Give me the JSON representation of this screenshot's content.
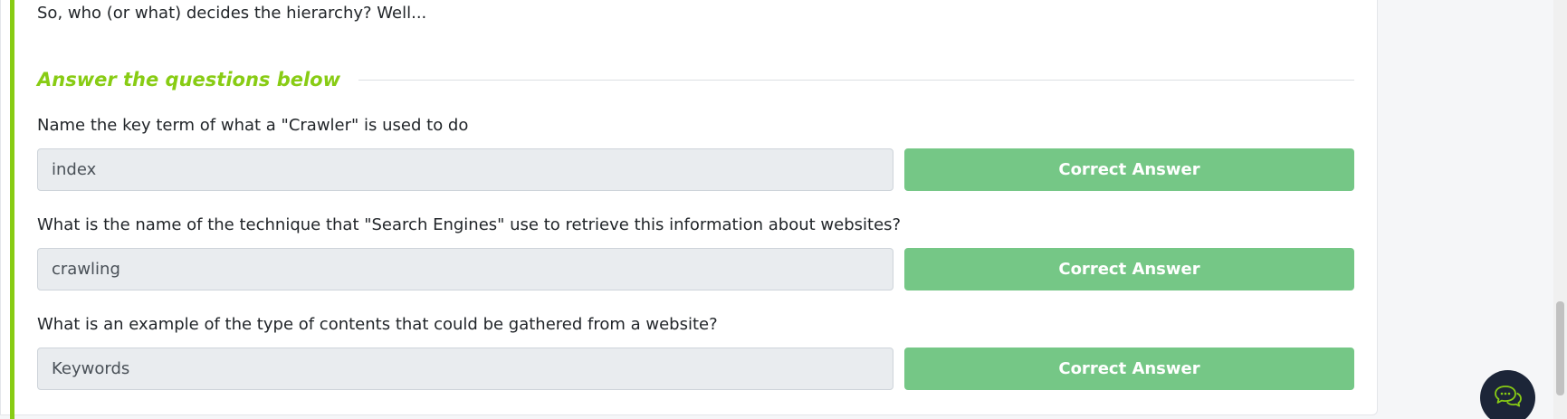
{
  "intro": {
    "text": "So, who (or what) decides the hierarchy? Well..."
  },
  "section": {
    "title": "Answer the questions below"
  },
  "questions": [
    {
      "text": "Name the key term of what a \"Crawler\" is used to do",
      "answer": "index",
      "button_label": "Correct Answer"
    },
    {
      "text": "What is the name of the technique that \"Search Engines\" use to retrieve this information about websites?",
      "answer": "crawling",
      "button_label": "Correct Answer"
    },
    {
      "text": "What is an example of the type of contents that could be gathered from a website?",
      "answer": "Keywords",
      "button_label": "Correct Answer"
    }
  ],
  "chat": {
    "icon": "chat-bubbles-icon"
  },
  "colors": {
    "accent": "#88cc14",
    "success": "#75c786",
    "input_bg": "#e9ecef",
    "chat_bg": "#1c2538"
  }
}
